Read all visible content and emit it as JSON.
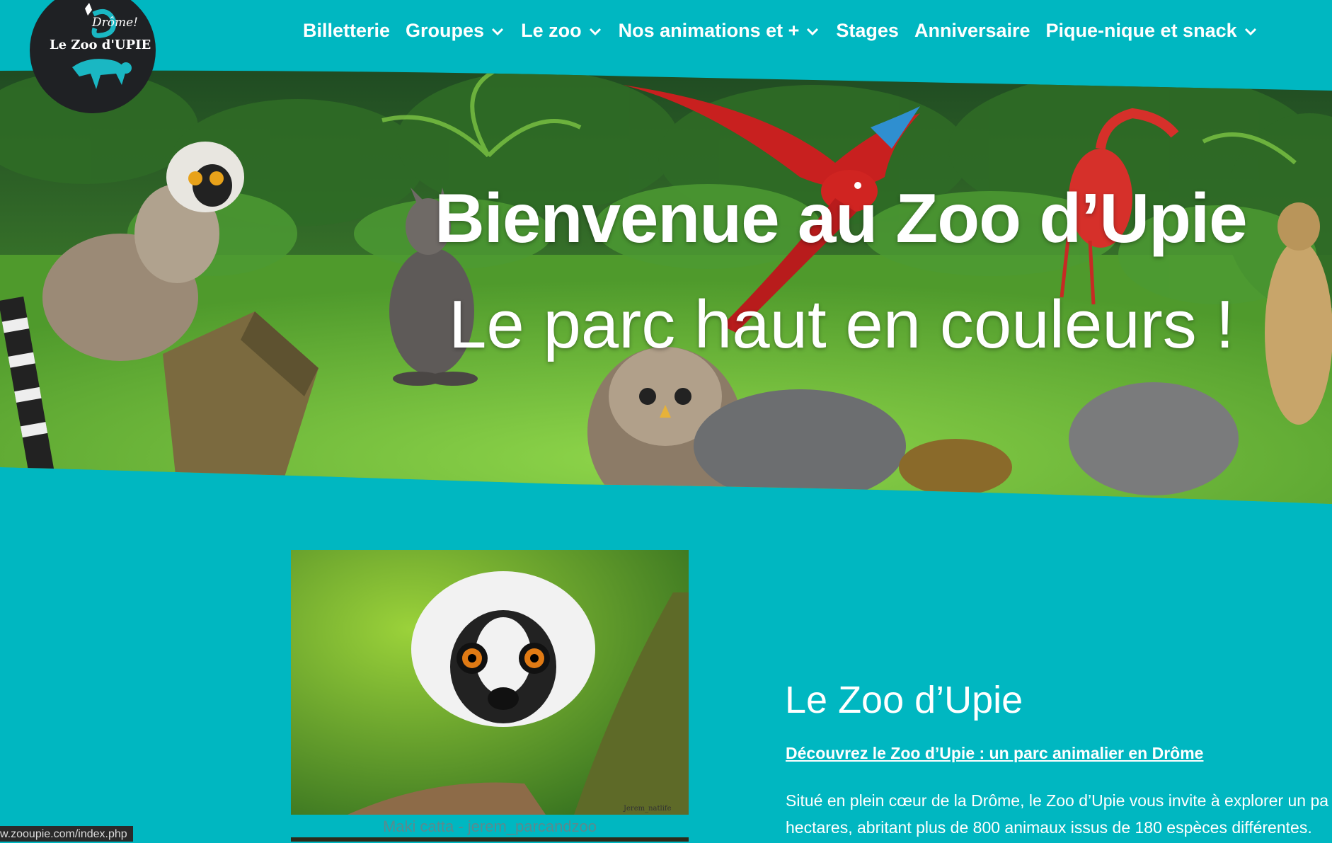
{
  "logo": {
    "drome": "Drôme!",
    "brand": "Le Zoo d'UPIE"
  },
  "nav": {
    "items": [
      {
        "label": "Billetterie",
        "dropdown": false
      },
      {
        "label": "Groupes",
        "dropdown": true
      },
      {
        "label": "Le zoo",
        "dropdown": true
      },
      {
        "label": "Nos animations et +",
        "dropdown": true
      },
      {
        "label": "Stages",
        "dropdown": false
      },
      {
        "label": "Anniversaire",
        "dropdown": false
      },
      {
        "label": "Pique-nique et snack",
        "dropdown": true
      }
    ]
  },
  "hero": {
    "title": "Bienvenue au Zoo d’Upie",
    "subtitle": "Le parc haut en couleurs !"
  },
  "content": {
    "image_caption": "Maki catta - jerem_parcandzoo",
    "image_watermark": "Jerem_natlife",
    "section_title": "Le Zoo d’Upie",
    "section_link": "Découvrez le Zoo d’Upie : un parc animalier en Drôme",
    "paragraph_line1": "Situé en plein cœur de la Drôme, le Zoo d’Upie vous invite à explorer un pa",
    "paragraph_line2": "hectares, abritant plus de 800 animaux issus de 180 espèces différentes."
  },
  "status_bar": {
    "url": "w.zooupie.com/index.php"
  },
  "colors": {
    "accent": "#00b7c1",
    "logo_bg": "#1f2124"
  }
}
